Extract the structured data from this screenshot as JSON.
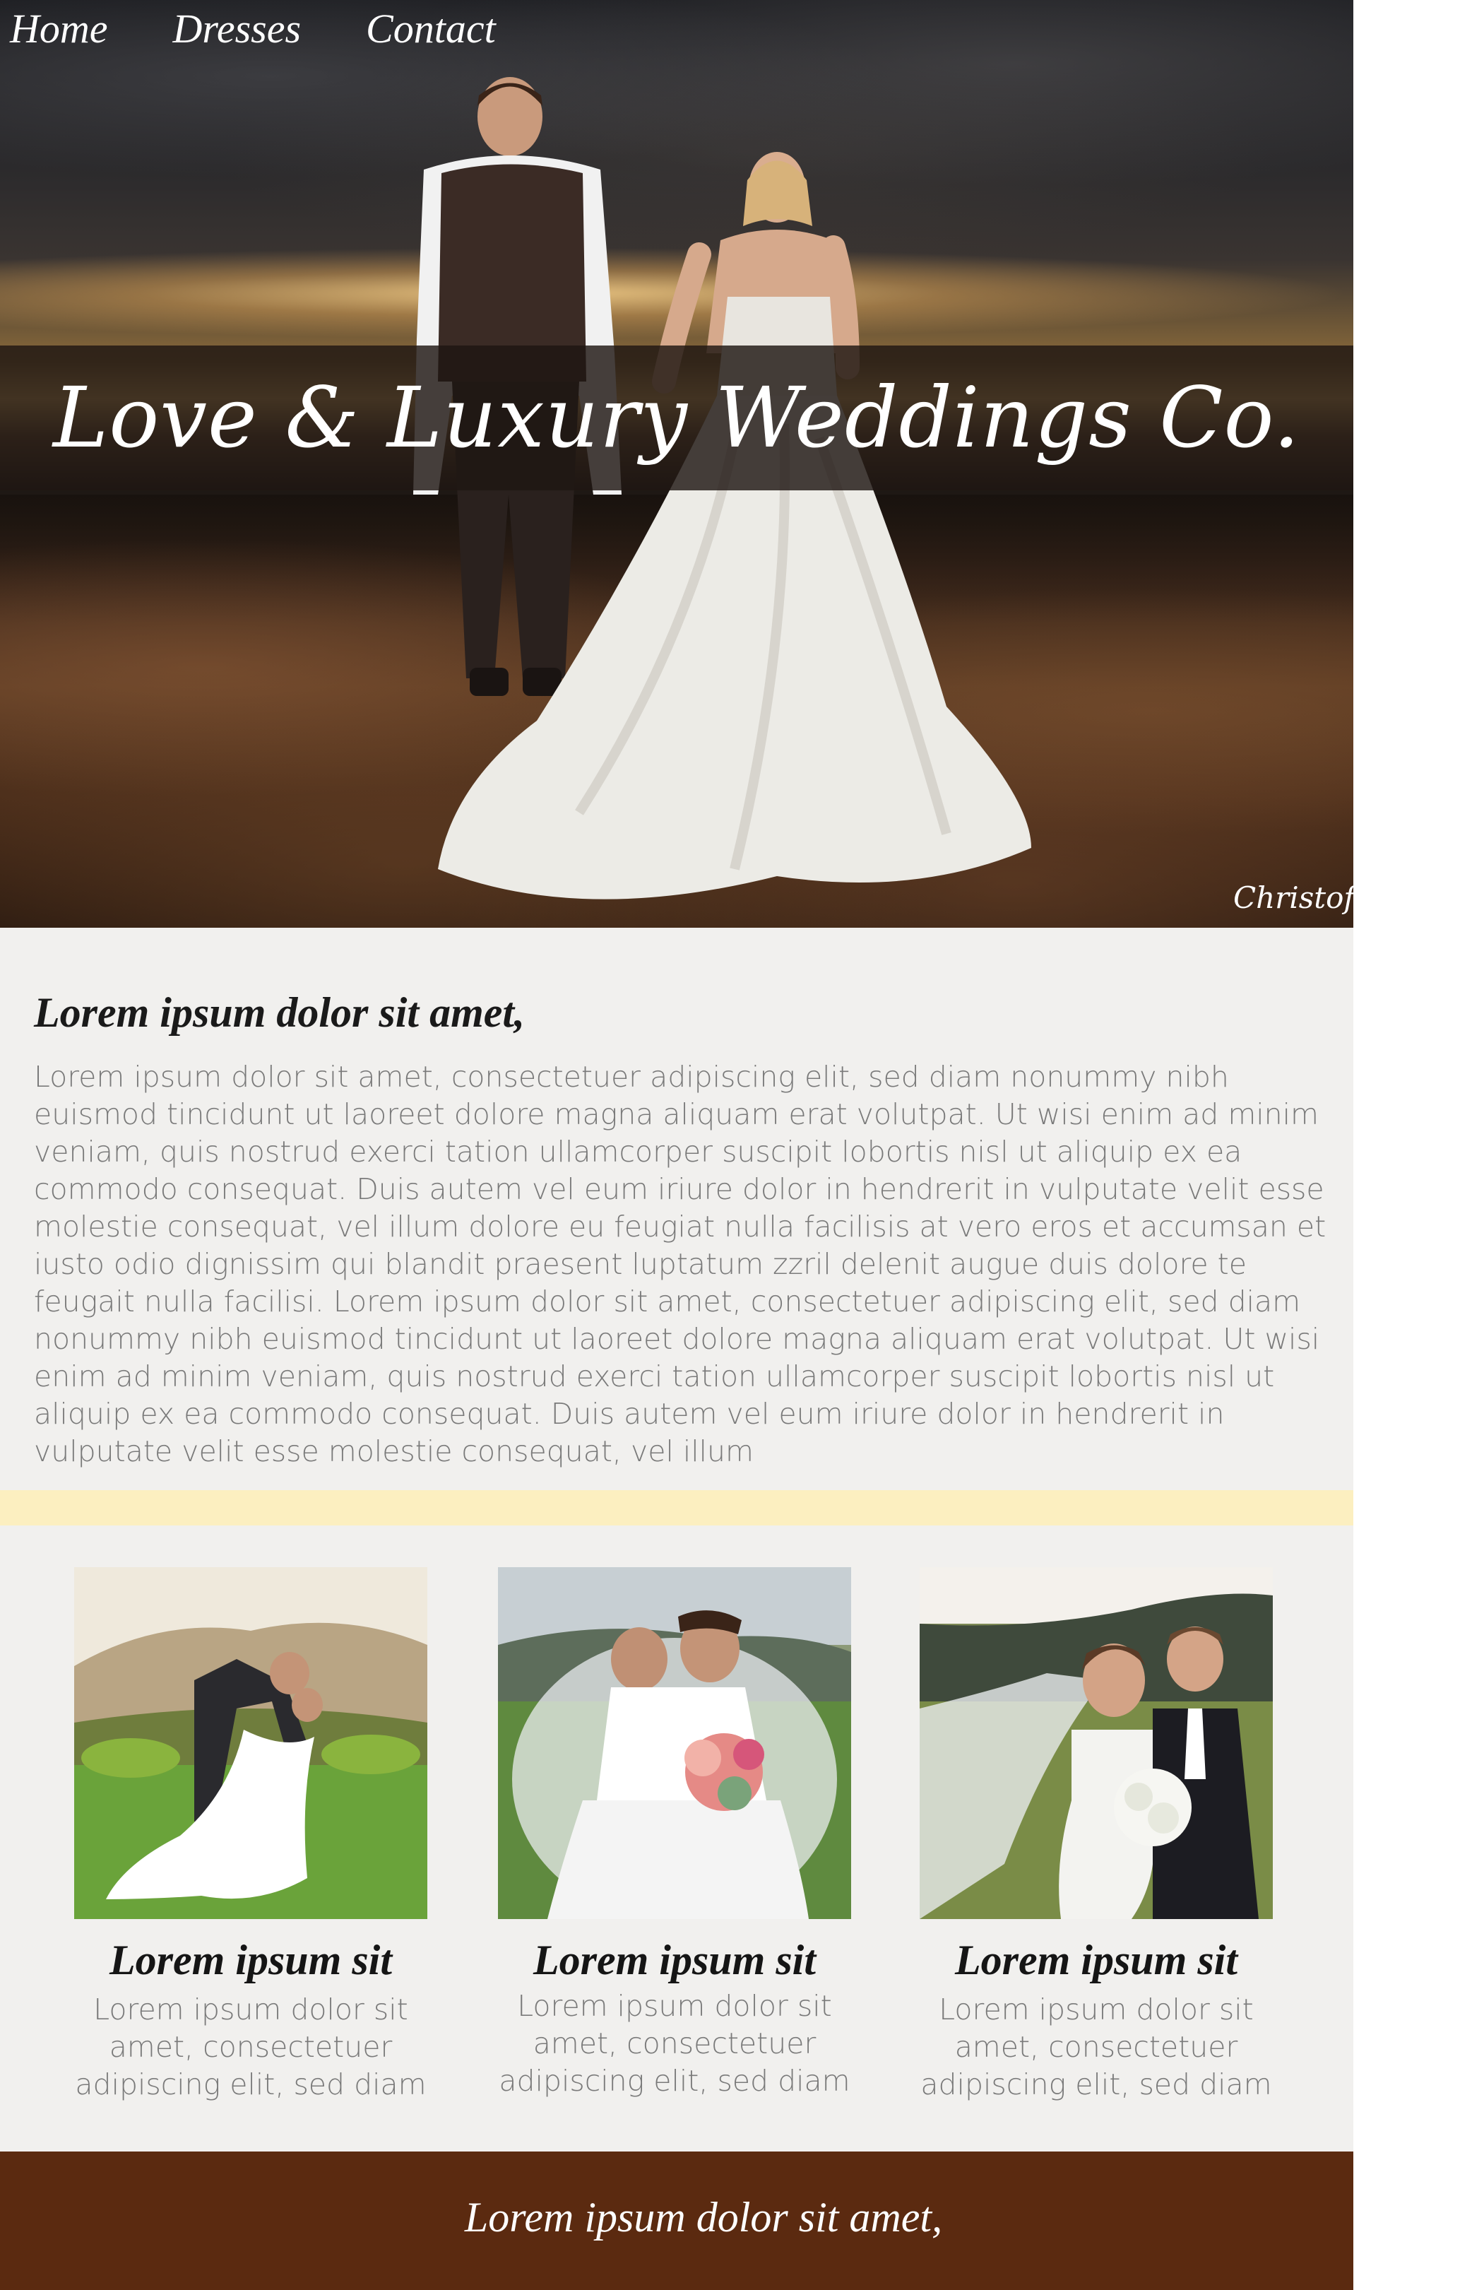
{
  "nav": {
    "items": [
      {
        "label": "Home"
      },
      {
        "label": "Dresses"
      },
      {
        "label": "Contact"
      }
    ]
  },
  "hero": {
    "title": "Love & Luxury Weddings Co.",
    "photo_credit": "Christof"
  },
  "intro": {
    "heading": "Lorem ipsum dolor sit amet,",
    "body": "Lorem ipsum dolor sit amet, consectetuer adipiscing elit, sed diam nonummy nibh euismod tincidunt ut laoreet dolore magna aliquam erat volutpat. Ut wisi enim ad minim veniam, quis nostrud exerci tation ullamcorper suscipit lobortis nisl ut aliquip ex ea commodo consequat. Duis autem vel eum iriure dolor in hendrerit in vulputate velit esse molestie consequat, vel illum dolore eu feugiat nulla facilisis at vero eros et accumsan et iusto odio dignissim qui blandit praesent luptatum zzril delenit augue duis dolore te feugait nulla facilisi. Lorem ipsum dolor sit amet, consectetuer adipiscing elit, sed diam nonummy nibh euismod tincidunt ut laoreet dolore magna aliquam erat volutpat. Ut wisi enim ad minim veniam, quis nostrud exerci tation ullamcorper suscipit lobortis nisl ut aliquip ex ea commodo consequat. Duis autem vel eum iriure dolor in hendrerit in vulputate velit esse molestie consequat, vel illum"
  },
  "cards": [
    {
      "title": "Lorem ipsum sit",
      "text": "Lorem ipsum dolor sit amet, consectetuer adipiscing elit, sed diam"
    },
    {
      "title": "Lorem ipsum sit",
      "text": "Lorem ipsum dolor sit amet, consectetuer adipiscing elit, sed diam"
    },
    {
      "title": "Lorem ipsum sit",
      "text": "Lorem ipsum dolor sit amet, consectetuer adipiscing elit, sed diam"
    }
  ],
  "footer": {
    "text": "Lorem ipsum dolor sit amet,"
  },
  "colors": {
    "page_background": "#f1f0ee",
    "accent_stripe": "#fcefc0",
    "footer_background": "#5b2a10",
    "body_text": "#7a7a7a",
    "heading_text": "#1a1a1a"
  }
}
